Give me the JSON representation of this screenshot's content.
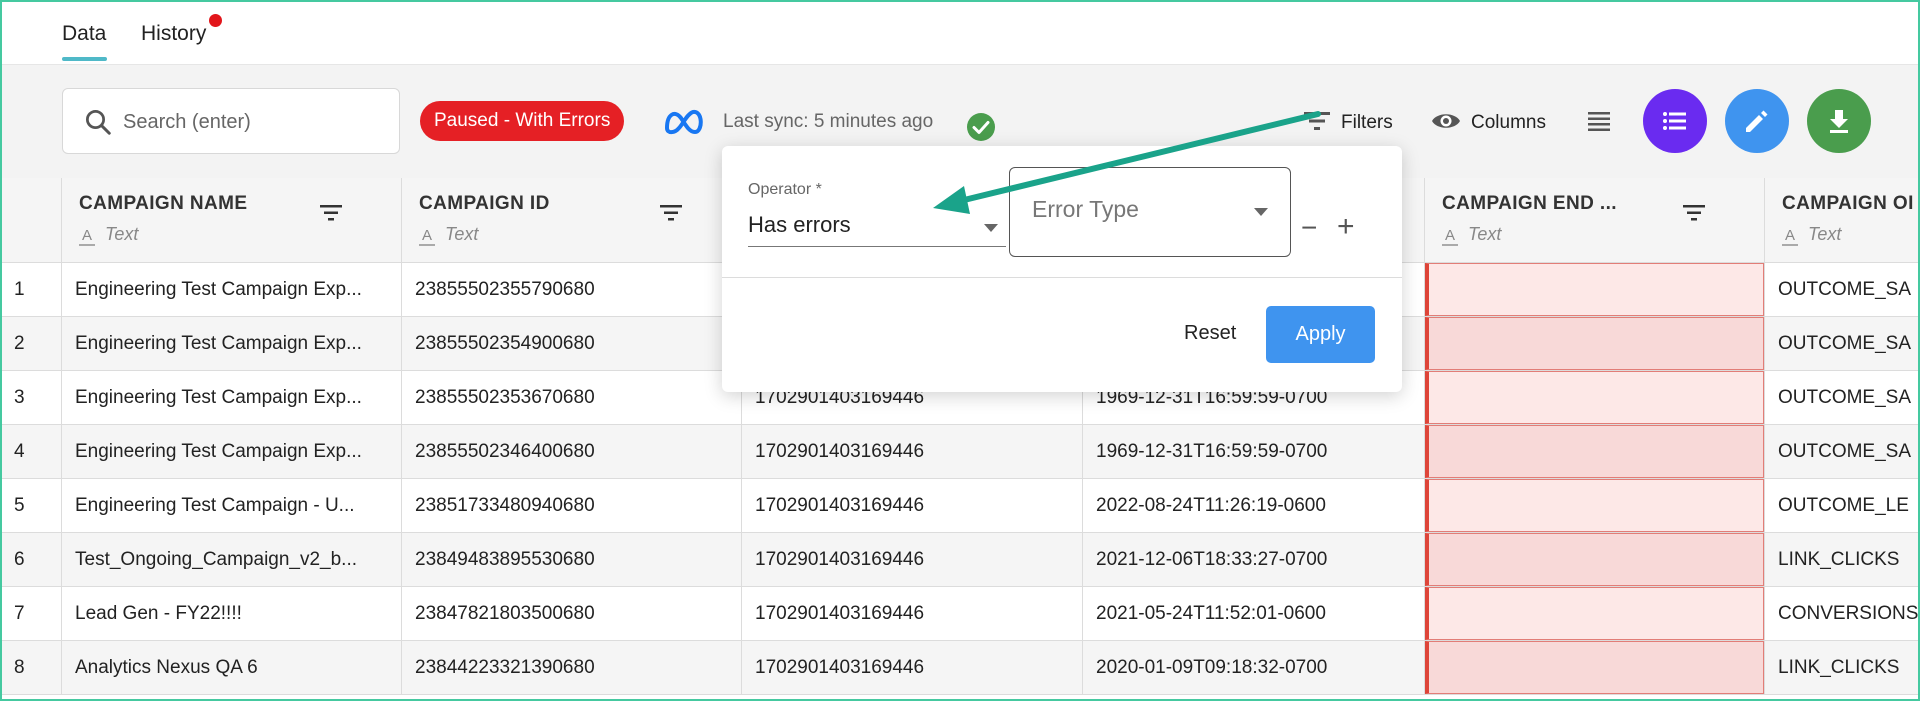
{
  "tabs": [
    {
      "label": "Data",
      "active": true
    },
    {
      "label": "History",
      "has_notification": true
    }
  ],
  "toolbar": {
    "search_placeholder": "Search (enter)",
    "status_badge": "Paused - With Errors",
    "sync_text": "Last sync: 5 minutes ago",
    "filters_label": "Filters",
    "columns_label": "Columns",
    "icons": [
      "search-icon",
      "meta-logo",
      "check-circle-icon",
      "filter-icon",
      "eye-icon",
      "density-icon",
      "list-icon",
      "pencil-icon",
      "download-icon"
    ],
    "colors": {
      "status_badge": "#e52025",
      "list_fab": "#6a2bf0",
      "edit_fab": "#3f94ef",
      "download_fab": "#4a9d4d",
      "sync_ok": "#4a9d4d"
    }
  },
  "grid": {
    "columns": [
      {
        "title": "CAMPAIGN NAME",
        "type": "Text"
      },
      {
        "title": "CAMPAIGN ID",
        "type": "Text"
      },
      {
        "title": "",
        "type": ""
      },
      {
        "title": "",
        "type": ""
      },
      {
        "title": "CAMPAIGN END ...",
        "type": "Text"
      },
      {
        "title": "CAMPAIGN OI",
        "type": "Text"
      }
    ],
    "rows": [
      {
        "index": "1",
        "name": "Engineering Test Campaign Exp...",
        "id": "23855502355790680",
        "account": "",
        "start": "",
        "end": "",
        "objective": "OUTCOME_SA"
      },
      {
        "index": "2",
        "name": "Engineering Test Campaign Exp...",
        "id": "23855502354900680",
        "account": "",
        "start": "",
        "end": "",
        "objective": "OUTCOME_SA"
      },
      {
        "index": "3",
        "name": "Engineering Test Campaign Exp...",
        "id": "23855502353670680",
        "account": "1702901403169446",
        "start": "1969-12-31T16:59:59-0700",
        "end": "",
        "objective": "OUTCOME_SA"
      },
      {
        "index": "4",
        "name": "Engineering Test Campaign Exp...",
        "id": "23855502346400680",
        "account": "1702901403169446",
        "start": "1969-12-31T16:59:59-0700",
        "end": "",
        "objective": "OUTCOME_SA"
      },
      {
        "index": "5",
        "name": "Engineering Test Campaign - U...",
        "id": "23851733480940680",
        "account": "1702901403169446",
        "start": "2022-08-24T11:26:19-0600",
        "end": "",
        "objective": "OUTCOME_LE"
      },
      {
        "index": "6",
        "name": "Test_Ongoing_Campaign_v2_b...",
        "id": "23849483895530680",
        "account": "1702901403169446",
        "start": "2021-12-06T18:33:27-0700",
        "end": "",
        "objective": "LINK_CLICKS"
      },
      {
        "index": "7",
        "name": "Lead Gen - FY22!!!!",
        "id": "23847821803500680",
        "account": "1702901403169446",
        "start": "2021-05-24T11:52:01-0600",
        "end": "",
        "objective": "CONVERSIONS"
      },
      {
        "index": "8",
        "name": "Analytics Nexus QA 6",
        "id": "23844223321390680",
        "account": "1702901403169446",
        "start": "2020-01-09T09:18:32-0700",
        "end": "",
        "objective": "LINK_CLICKS"
      }
    ],
    "error_color": "#de4539"
  },
  "filter_popover": {
    "operator_label": "Operator *",
    "operator_value": "Has errors",
    "value_placeholder": "Error Type",
    "reset_label": "Reset",
    "apply_label": "Apply",
    "minus_label": "−",
    "plus_label": "+",
    "annotation_arrow_color": "#1aa38a"
  }
}
